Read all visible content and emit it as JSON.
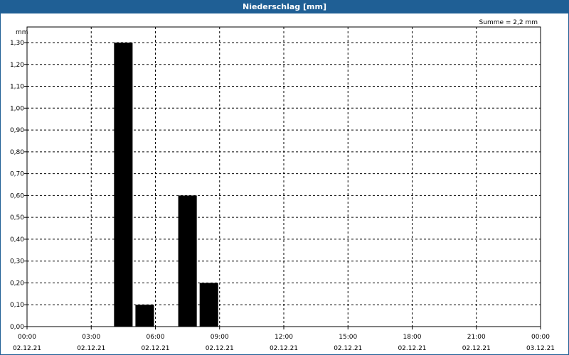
{
  "title_bar": {
    "title": "Niederschlag [mm]"
  },
  "chart_data": {
    "type": "bar",
    "title": "Niederschlag [mm]",
    "ylabel": "mm",
    "summary": "Summe = 2,2 mm",
    "ylim": [
      0,
      1.3
    ],
    "y_ticks": [
      "0,00",
      "0,10",
      "0,20",
      "0,30",
      "0,40",
      "0,50",
      "0,60",
      "0,70",
      "0,80",
      "0,90",
      "1,00",
      "1,10",
      "1,20",
      "1,30"
    ],
    "x_range_hours": [
      0,
      24
    ],
    "x_ticks": [
      {
        "time": "00:00",
        "date": "02.12.21"
      },
      {
        "time": "03:00",
        "date": "02.12.21"
      },
      {
        "time": "06:00",
        "date": "02.12.21"
      },
      {
        "time": "09:00",
        "date": "02.12.21"
      },
      {
        "time": "12:00",
        "date": "02.12.21"
      },
      {
        "time": "15:00",
        "date": "02.12.21"
      },
      {
        "time": "18:00",
        "date": "02.12.21"
      },
      {
        "time": "21:00",
        "date": "02.12.21"
      },
      {
        "time": "00:00",
        "date": "03.12.21"
      }
    ],
    "bars": [
      {
        "start": "04:00",
        "end": "05:00",
        "value": 1.3
      },
      {
        "start": "05:00",
        "end": "06:00",
        "value": 0.1
      },
      {
        "start": "07:00",
        "end": "08:00",
        "value": 0.6
      },
      {
        "start": "08:00",
        "end": "09:00",
        "value": 0.2
      }
    ],
    "grid": true,
    "colors": {
      "bar": "#000000",
      "title_bar": "#1f5f95",
      "grid": "#000000"
    }
  }
}
